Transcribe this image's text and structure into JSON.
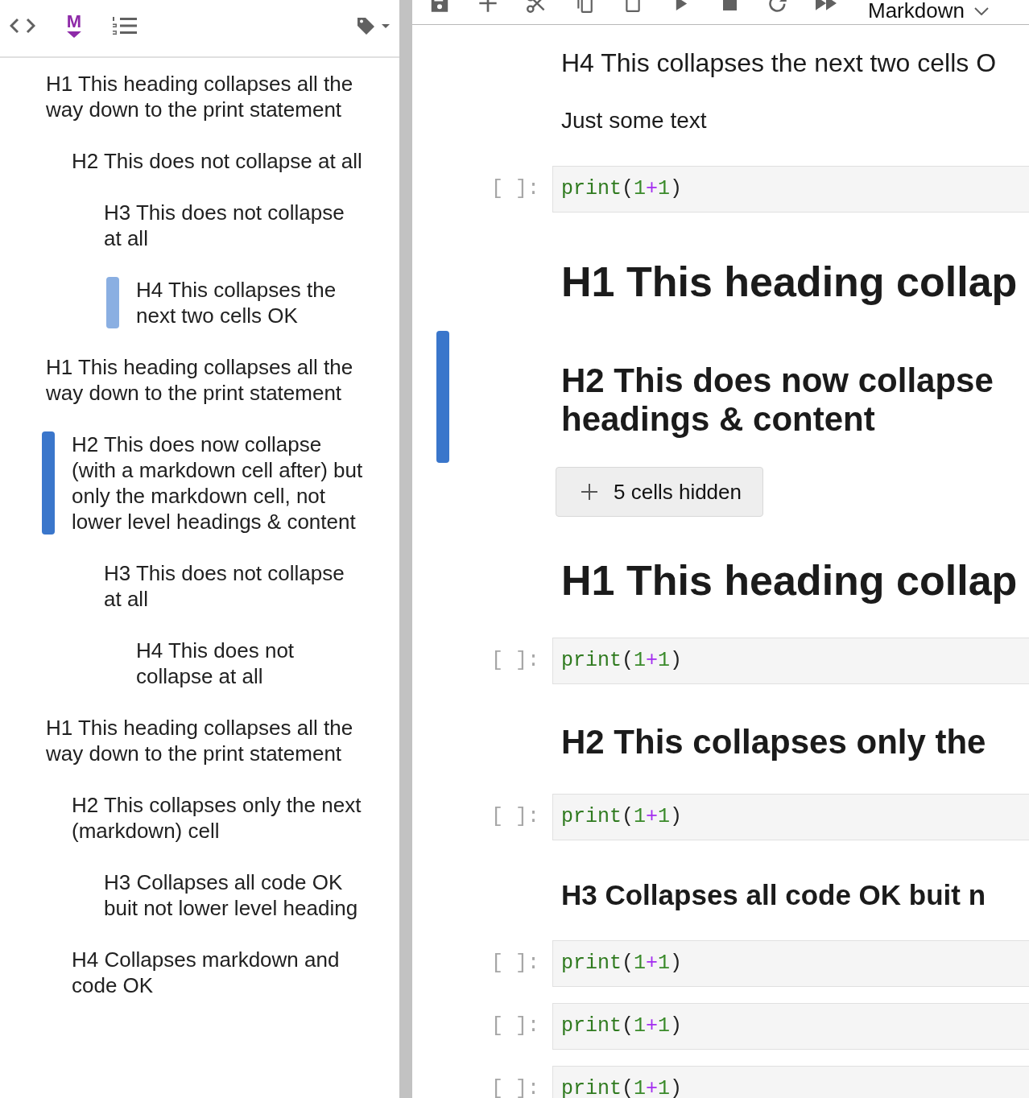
{
  "sidebar": {
    "toolbar": [
      {
        "kind": "code"
      },
      {
        "kind": "markdown",
        "letter": "M"
      },
      {
        "kind": "numbered-list"
      },
      {
        "kind": "tags"
      }
    ],
    "toc": [
      {
        "text": "H1 This heading collapses all the way down to the print statement",
        "active": false,
        "selected": false,
        "children": [
          {
            "text": "H2 This does not collapse at all",
            "active": false,
            "selected": false,
            "children": [
              {
                "text": "H3 This does not collapse at all",
                "active": false,
                "selected": false,
                "children": [
                  {
                    "text": "H4 This collapses the next two cells OK",
                    "active": false,
                    "selected": true
                  }
                ]
              }
            ]
          }
        ]
      },
      {
        "text": "H1 This heading collapses all the way down to the print statement",
        "active": false,
        "selected": false,
        "children": [
          {
            "text": "H2 This does now collapse (with a markdown cell after) but only the markdown cell, not lower level headings & content",
            "active": true,
            "selected": false,
            "children": [
              {
                "text": "H3 This does not collapse at all",
                "active": false,
                "selected": false,
                "children": [
                  {
                    "text": "H4 This does not collapse at all",
                    "active": false,
                    "selected": false
                  }
                ]
              }
            ]
          }
        ]
      },
      {
        "text": "H1 This heading collapses all the way down to the print statement",
        "active": false,
        "selected": false,
        "children": [
          {
            "text": "H2 This collapses only the next (markdown) cell",
            "active": false,
            "selected": false,
            "children": [
              {
                "text": "H3 Collapses all code OK buit not lower level heading",
                "active": false,
                "selected": false
              }
            ]
          },
          {
            "text": "H4 Collapses markdown and code OK",
            "active": false,
            "selected": false
          }
        ]
      }
    ]
  },
  "notebook": {
    "toolbar": {
      "buttons": [
        {
          "kind": "save"
        },
        {
          "kind": "add"
        },
        {
          "kind": "cut"
        },
        {
          "kind": "copy"
        },
        {
          "kind": "paste"
        },
        {
          "kind": "run"
        },
        {
          "kind": "stop"
        },
        {
          "kind": "restart"
        },
        {
          "kind": "run-all"
        }
      ],
      "cell_type": "Markdown"
    },
    "cells": [
      {
        "kind": "h4",
        "lines": [
          "H4 This collapses the next two cells O"
        ],
        "selected": false
      },
      {
        "kind": "paragraph",
        "lines": [
          "Just some text"
        ],
        "selected": false
      },
      {
        "kind": "code",
        "prompt": "[ ]:",
        "code": "print(1+1)",
        "selected": false
      },
      {
        "kind": "h1",
        "lines": [
          "H1 This heading collap"
        ],
        "selected": false
      },
      {
        "kind": "h2",
        "lines": [
          "H2 This does now collapse",
          "headings & content"
        ],
        "selected": true,
        "hidden_cells": "5 cells hidden"
      },
      {
        "kind": "h1",
        "lines": [
          "H1 This heading collap"
        ],
        "selected": false
      },
      {
        "kind": "code",
        "prompt": "[ ]:",
        "code": "print(1+1)",
        "selected": false
      },
      {
        "kind": "h2",
        "lines": [
          "H2 This collapses only the"
        ],
        "selected": false
      },
      {
        "kind": "code",
        "prompt": "[ ]:",
        "code": "print(1+1)",
        "selected": false
      },
      {
        "kind": "h3",
        "lines": [
          "H3 Collapses all code OK buit n"
        ],
        "selected": false
      },
      {
        "kind": "code",
        "prompt": "[ ]:",
        "code": "print(1+1)",
        "selected": false
      },
      {
        "kind": "code",
        "prompt": "[ ]:",
        "code": "print(1+1)",
        "selected": false
      },
      {
        "kind": "code",
        "prompt": "[ ]:",
        "code": "print(1+1)",
        "selected": false
      }
    ]
  }
}
